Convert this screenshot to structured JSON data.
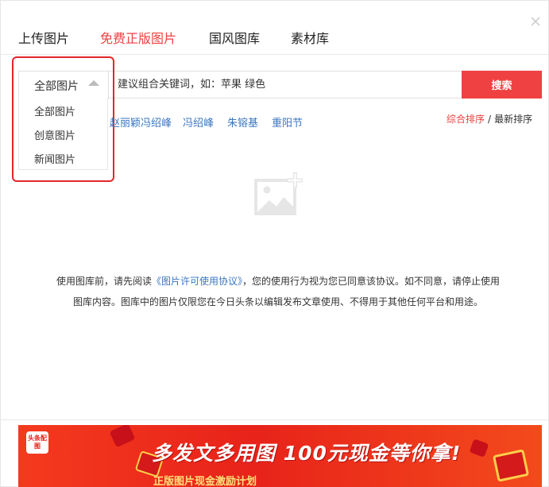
{
  "tabs": [
    {
      "label": "上传图片",
      "active": false
    },
    {
      "label": "免费正版图片",
      "active": true
    },
    {
      "label": "国风图库",
      "active": false
    },
    {
      "label": "素材库",
      "active": false
    }
  ],
  "search": {
    "scope_label": "全部图片",
    "placeholder": "建议组合关键词，如：苹果 绿色",
    "button_label": "搜索"
  },
  "dropdown": {
    "items": [
      "全部图片",
      "创意图片",
      "新闻图片"
    ]
  },
  "hot_keywords": [
    "赵丽颖冯绍峰",
    "冯绍峰",
    "朱镕基",
    "重阳节"
  ],
  "sort": {
    "option_a": "综合排序",
    "separator": "/",
    "option_b": "最新排序",
    "active": "综合排序"
  },
  "notice": {
    "prefix": "使用图库前，请先阅读",
    "link": "《图片许可使用协议》",
    "suffix": "，您的使用行为视为您已同意该协议。如不同意，请停止使用图库内容。图库中的图片仅限您在今日头条以编辑发布文章使用、不得用于其他任何平台和用途。"
  },
  "banner": {
    "logo_text": "头条配图",
    "headline": "多发文多用图 100元现金等你拿!",
    "subline": "正版图片现金激励计划"
  },
  "icons": {
    "close": "close-icon",
    "caret": "caret-up-icon",
    "empty": "image-add-icon"
  },
  "colors": {
    "accent": "#f04142",
    "link": "#3a76c0",
    "highlight": "#e5262b"
  }
}
